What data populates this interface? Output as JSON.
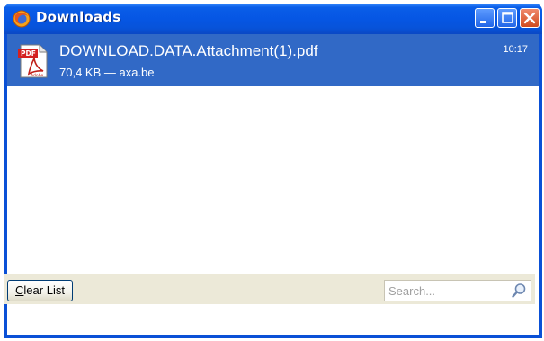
{
  "window": {
    "title": "Downloads",
    "app_icon": "firefox-icon",
    "controls": [
      "minimize-icon",
      "maximize-icon",
      "close-icon"
    ]
  },
  "downloads": [
    {
      "file_name": "DOWNLOAD.DATA.Attachment(1).pdf",
      "meta": "70,4 KB — axa.be",
      "time": "10:17",
      "icon": "pdf-icon",
      "selected": true
    }
  ],
  "footer": {
    "clear_label_first": "C",
    "clear_label_rest": "lear List",
    "search_placeholder": "Search...",
    "search_value": "",
    "search_icon": "magnifier-icon"
  },
  "colors": {
    "titlebar": "#0656e4",
    "selection": "#3169c6",
    "footer_bg": "#ece9d8"
  }
}
